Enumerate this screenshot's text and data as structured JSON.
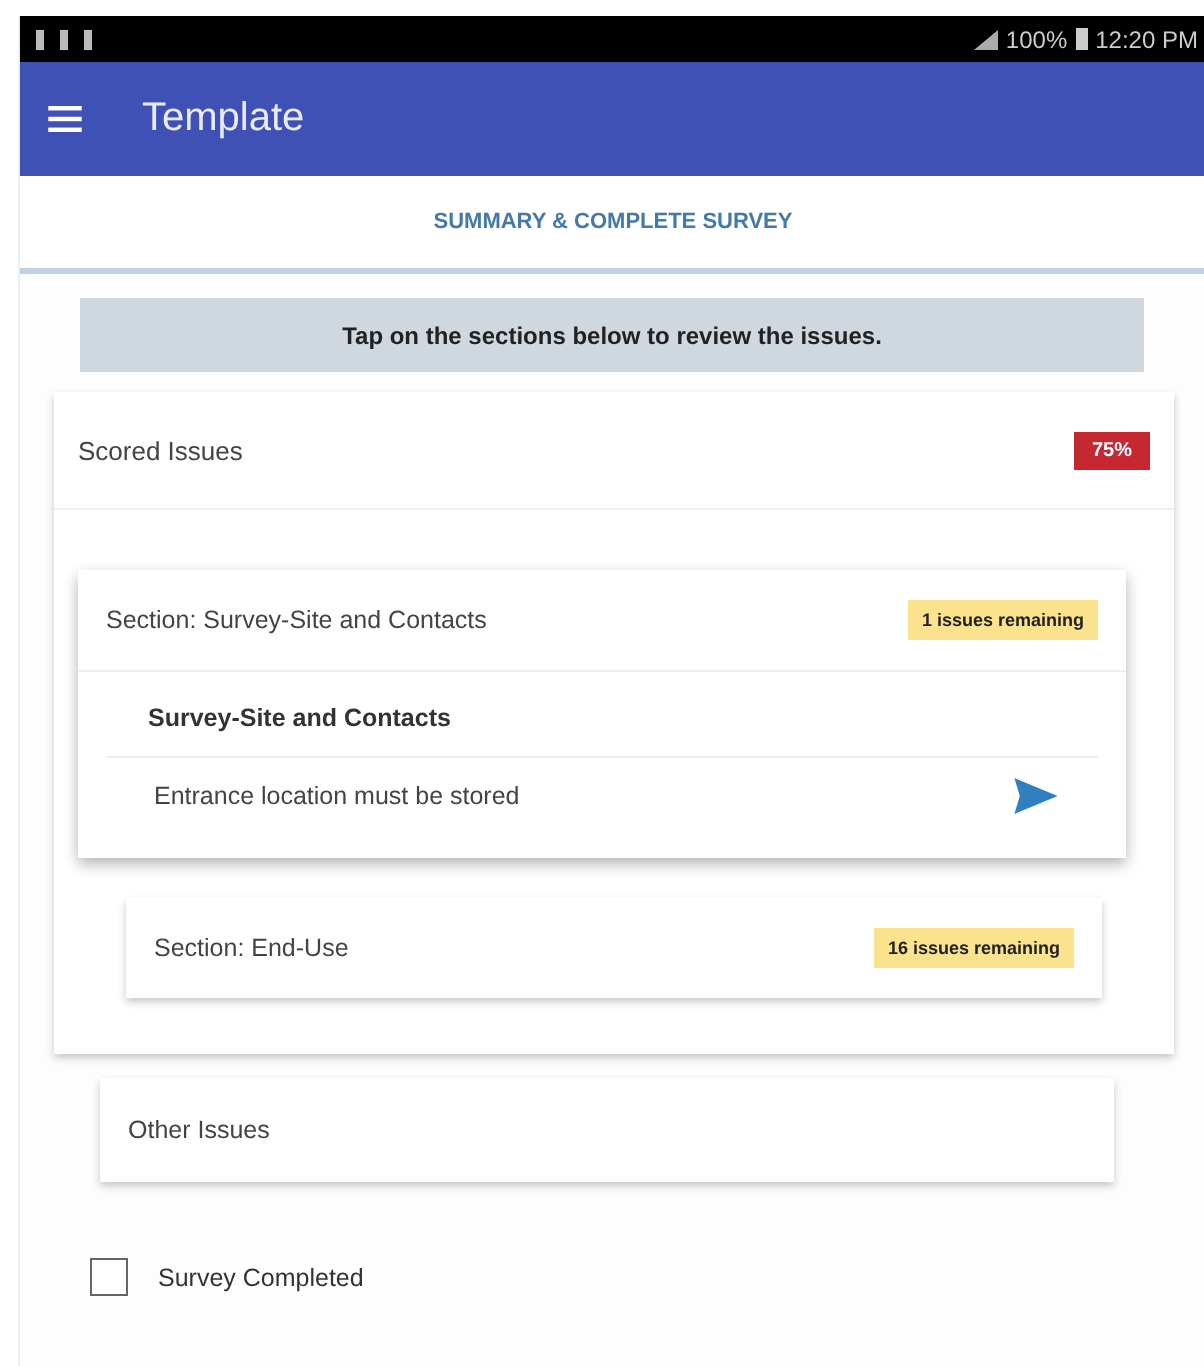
{
  "status_bar": {
    "battery": "100%",
    "time": "12:20 PM"
  },
  "app_bar": {
    "title": "Template"
  },
  "tab": {
    "label": "SUMMARY & COMPLETE SURVEY",
    "selected": true
  },
  "banner": "Tap on the sections below to review the issues.",
  "scored_issues": {
    "title": "Scored Issues",
    "score": "75%",
    "sections": [
      {
        "title": "Section: Survey-Site and Contacts",
        "badge": "1 issues remaining",
        "expanded": true,
        "group": "Survey-Site and Contacts",
        "issues": [
          "Entrance location must be stored"
        ]
      },
      {
        "title": "Section: End-Use",
        "badge": "16 issues remaining",
        "expanded": false
      }
    ]
  },
  "other_issues": {
    "title": "Other Issues"
  },
  "survey_completed": {
    "label": "Survey Completed",
    "checked": false
  }
}
